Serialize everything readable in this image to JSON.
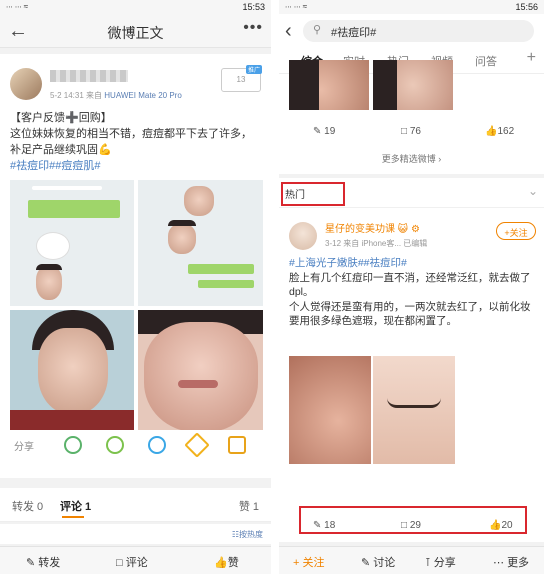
{
  "left": {
    "status": {
      "signals": "∙∙∙ ∙∙∙ ≈",
      "time": "15:53"
    },
    "nav": {
      "title": "微博正文"
    },
    "post": {
      "meta_time": "5-2 14:31",
      "meta_from": "来自",
      "meta_device": "HUAWEI Mate 20 Pro",
      "follow_count": "13",
      "follow_tag": "推广",
      "text_line1": "【客户反馈➕回购】",
      "text_line2": "这位妹妹恢复的相当不错，痘痘都平下去了许多，",
      "text_line3": "补足产品继续巩固💪",
      "hashtags": "#祛痘印##痘痘肌#"
    },
    "share": {
      "label": "分享"
    },
    "tabs": {
      "repost": "转发 0",
      "comment": "评论 1",
      "like": "赞 1"
    },
    "sort": {
      "label": "☷按热度"
    },
    "bottom": {
      "repost": "转发",
      "comment": "评论",
      "like": "赞"
    }
  },
  "right": {
    "status": {
      "signals": "∙∙∙ ∙∙∙ ≈",
      "time": "15:56"
    },
    "search": {
      "query": "#祛痘印#"
    },
    "tabs": [
      "综合",
      "实时",
      "热门",
      "视频",
      "问答"
    ],
    "card1": {
      "repost": "19",
      "comment": "76",
      "like": "162",
      "more": "更多精选微博 ›"
    },
    "hot_label": "热门",
    "post": {
      "name": "星仔的变美功课",
      "badges": "😺 ⚙",
      "meta_date": "3-12",
      "meta_from": "来自 iPhone客...",
      "meta_edited": "已编辑",
      "follow": "+关注",
      "hashtags": "#上海光子嫩肤##祛痘印#",
      "text1": "脸上有几个红痘印一直不消，还经常泛红，就去做了dpl。",
      "text2": "个人觉得还是蛮有用的，一两次就去红了，以前化妆要用很多绿色遮瑕，现在都闲置了。",
      "repost": "18",
      "comment": "29",
      "like": "20"
    },
    "bottom": {
      "follow": "+ 关注",
      "discuss": "讨论",
      "share": "分享",
      "more": "更多"
    }
  },
  "colors": {
    "accent": "#f08300",
    "link": "#4a7fc1",
    "highlight_box": "#d9272e"
  }
}
